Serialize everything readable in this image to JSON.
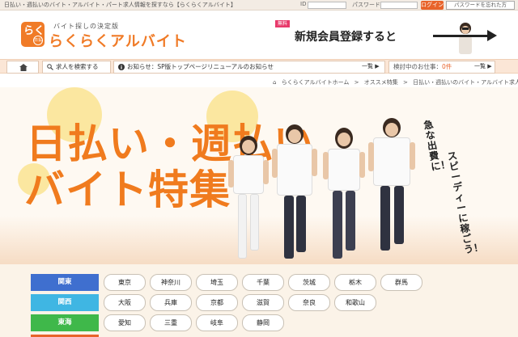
{
  "topbar": {
    "tagline": "日払い・週払いのバイト・アルバイト・パート求人情報を探すなら【らくらくアルバイト】",
    "id_label": "ID",
    "password_label": "パスワード",
    "login_label": "ログイン",
    "forgot_label": "パスワードを忘れた方"
  },
  "header": {
    "logo_mark": "らく",
    "logo_badge": "日払",
    "logo_sub": "バイト探しの決定版",
    "logo_name": "らくらくアルバイト",
    "register_badge": "無料",
    "register_text": "新規会員登録すると"
  },
  "nav": {
    "search_label": "求人を検索する",
    "news_label": "お知らせ：SP版トップページリニューアルのお知らせ",
    "news_list": "一覧",
    "consider_label": "検討中のお仕事：",
    "consider_count": "0件",
    "consider_list": "一覧"
  },
  "breadcrumb": [
    "らくらくアルバイトホーム",
    "オススメ特集",
    "日払い・週払いのバイト・アルバイト求人"
  ],
  "hero": {
    "title_line1": "日払い・週払い",
    "title_line2": "バイト特集",
    "vertical_text1": "スピーディーに稼ごう！",
    "vertical_text2": "急な出費に！"
  },
  "regions": [
    {
      "name": "関東",
      "color": "#3f6fcf",
      "prefs": [
        "東京",
        "神奈川",
        "埼玉",
        "千葉",
        "茨城",
        "栃木",
        "群馬"
      ]
    },
    {
      "name": "関西",
      "color": "#3fb6e3",
      "prefs": [
        "大阪",
        "兵庫",
        "京都",
        "滋賀",
        "奈良",
        "和歌山"
      ]
    },
    {
      "name": "東海",
      "color": "#3fb84a",
      "prefs": [
        "愛知",
        "三重",
        "岐阜",
        "静岡"
      ]
    }
  ]
}
